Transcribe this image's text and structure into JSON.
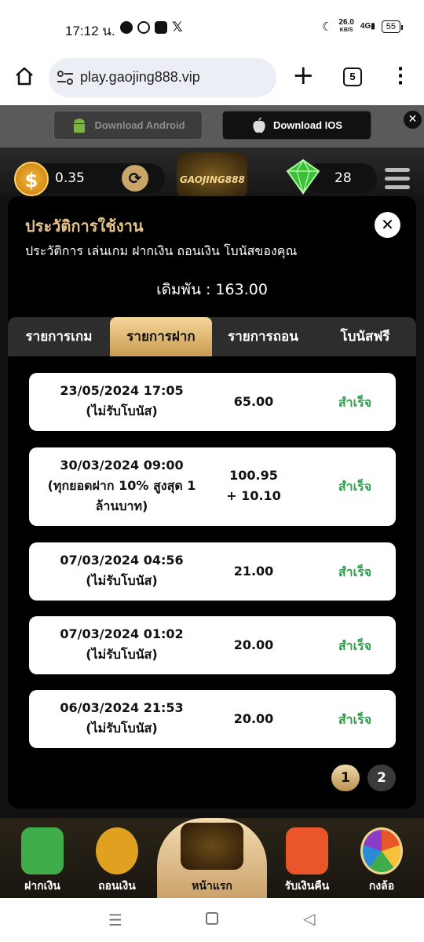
{
  "status_bar": {
    "time": "17:12 น.",
    "net_speed": "26.0",
    "net_unit": "KB/S",
    "signal": "4G",
    "battery": "55"
  },
  "browser": {
    "url": "play.gaojing888.vip",
    "tab_count": "5"
  },
  "download_bar": {
    "android_label": "Download Android",
    "ios_label": "Download IOS"
  },
  "game_header": {
    "balance": "0.35",
    "gems": "28",
    "logo_text": "GAOJING888"
  },
  "modal": {
    "title": "ประวัติการใช้งาน",
    "subtitle": "ประวัติการ เล่นเกม ฝากเงิน ถอนเงิน โบนัสของคุณ",
    "turnover": "เดิมพัน : 163.00",
    "tabs": [
      "รายการเกม",
      "รายการฝาก",
      "รายการถอน",
      "โบนัสฟรี"
    ],
    "active_tab": 1,
    "rows": [
      {
        "date": "23/05/2024 17:05",
        "note": "(ไม่รับโบนัส)",
        "amount": "65.00",
        "amount2": "",
        "status": "สำเร็จ"
      },
      {
        "date": "30/03/2024 09:00",
        "note": "(ทุกยอดฝาก 10% สูงสุด 1 ล้านบาท)",
        "amount": "100.95",
        "amount2": "+ 10.10",
        "status": "สำเร็จ"
      },
      {
        "date": "07/03/2024 04:56",
        "note": "(ไม่รับโบนัส)",
        "amount": "21.00",
        "amount2": "",
        "status": "สำเร็จ"
      },
      {
        "date": "07/03/2024 01:02",
        "note": "(ไม่รับโบนัส)",
        "amount": "20.00",
        "amount2": "",
        "status": "สำเร็จ"
      },
      {
        "date": "06/03/2024 21:53",
        "note": "(ไม่รับโบนัส)",
        "amount": "20.00",
        "amount2": "",
        "status": "สำเร็จ"
      }
    ],
    "pages": [
      "1",
      "2"
    ],
    "current_page": "1"
  },
  "bottom_nav": [
    {
      "label": "ฝากเงิน",
      "color": "#3fae4a"
    },
    {
      "label": "ถอนเงิน",
      "color": "#e0a020"
    },
    {
      "label": "หน้าแรก",
      "color": "#caa26b"
    },
    {
      "label": "รับเงินคืน",
      "color": "#e8562a"
    },
    {
      "label": "กงล้อ",
      "color": "#8c3cc8"
    }
  ],
  "colors": {
    "accent_gold": "#e8c48a",
    "success": "#2aa24a"
  }
}
